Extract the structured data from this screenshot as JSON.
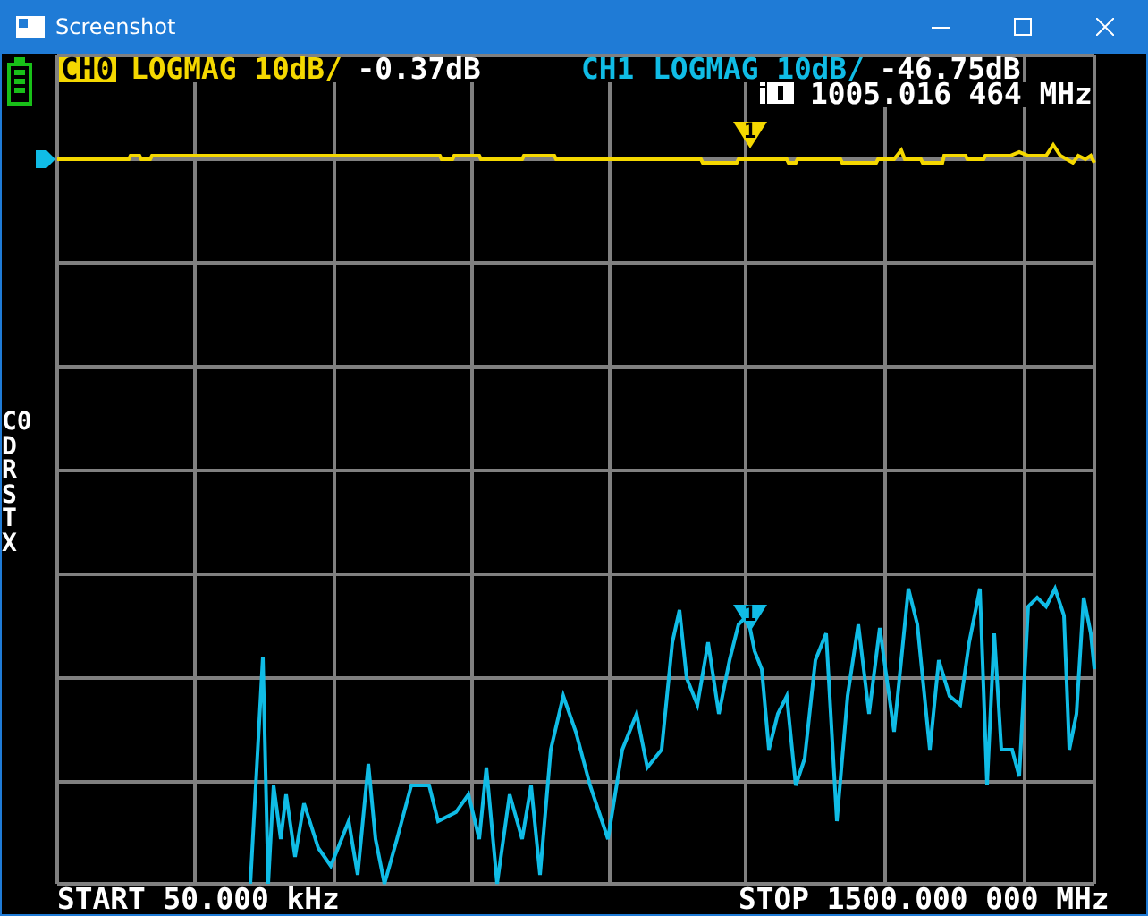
{
  "window": {
    "title": "Screenshot"
  },
  "channels": [
    {
      "label": "CH0",
      "selected": true,
      "format": "LOGMAG 10dB/",
      "reading": "-0.37dB",
      "color": "#f5d800",
      "marker_label": "1"
    },
    {
      "label": "CH1",
      "selected": false,
      "format": "LOGMAG 10dB/",
      "reading": "-46.75dB",
      "color": "#10bce6",
      "marker_label": "1"
    }
  ],
  "marker": {
    "frequency": "1005.016 464 MHz"
  },
  "side_labels": [
    "C0",
    "D",
    "R",
    "S",
    "T",
    "X"
  ],
  "sweep": {
    "start": "START 50.000 kHz",
    "stop": "STOP 1500.000 000 MHz"
  }
}
